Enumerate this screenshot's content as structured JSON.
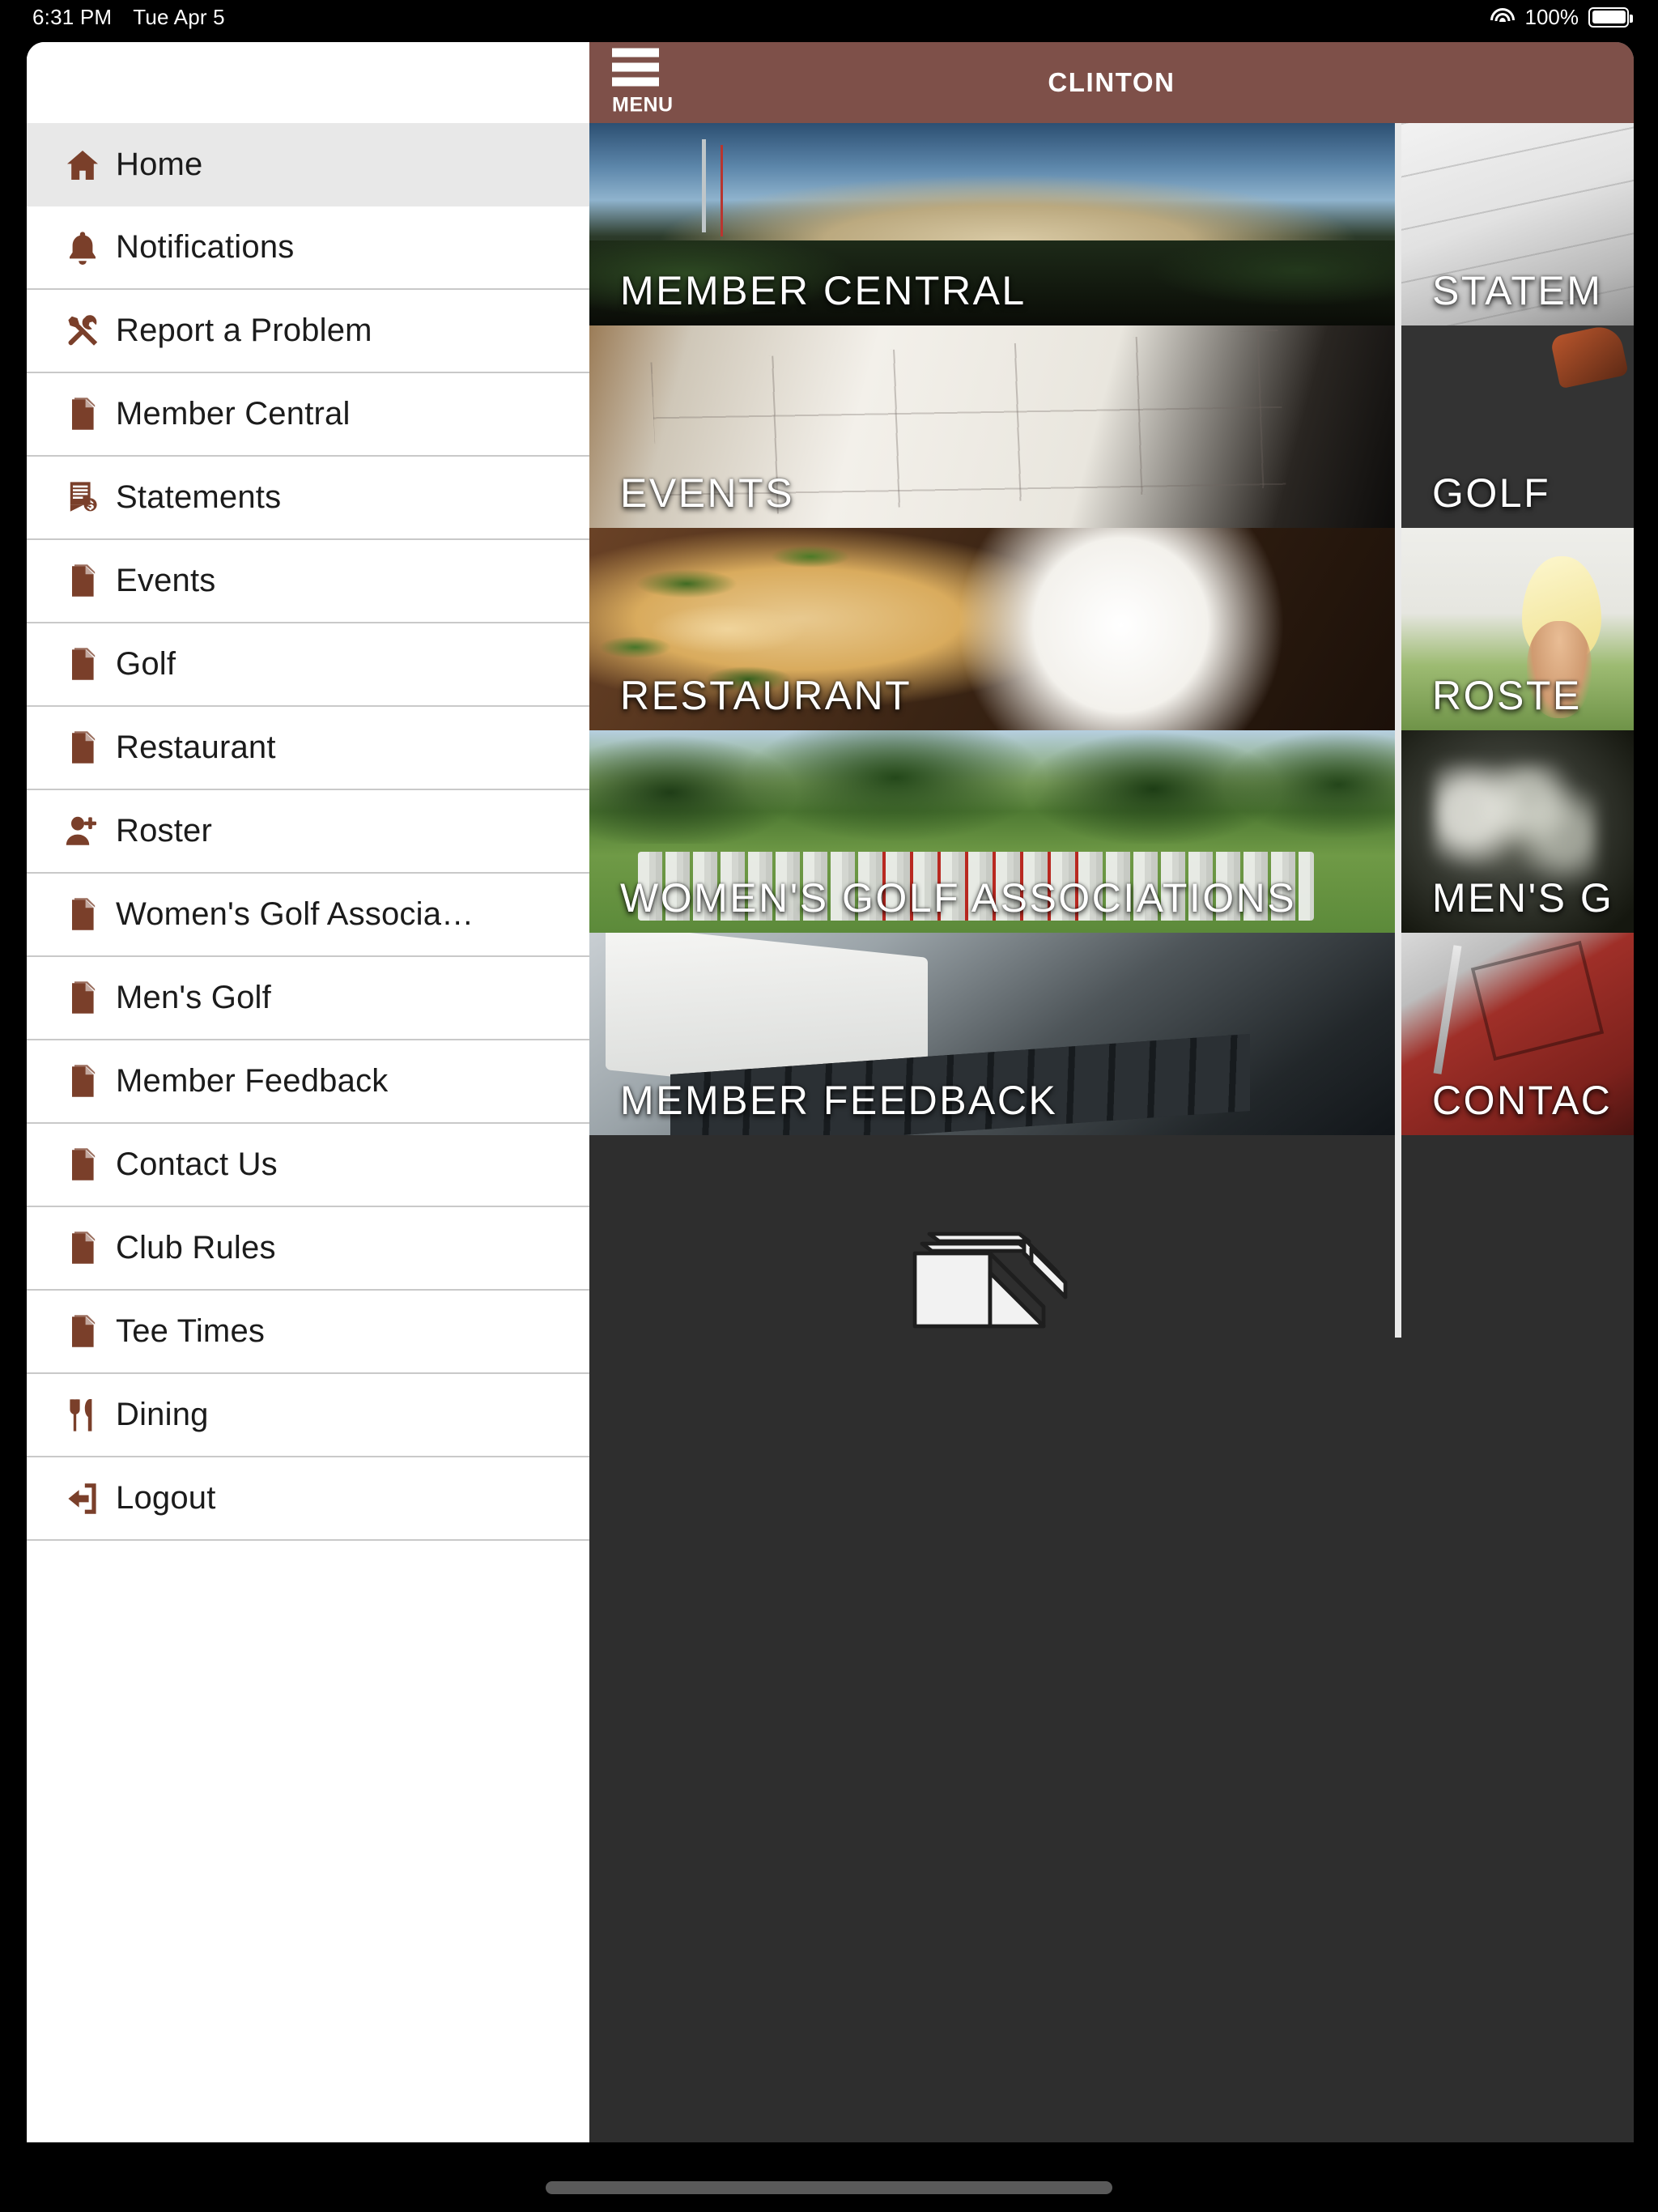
{
  "status_bar": {
    "time": "6:31 PM",
    "date": "Tue Apr 5",
    "battery_percent": "100%",
    "wifi_icon": "wifi-icon",
    "battery_icon": "battery-full-icon"
  },
  "header": {
    "menu_label": "MENU",
    "menu_icon": "hamburger-menu-icon",
    "title": "CLINTON",
    "background_color": "#7e5049"
  },
  "sidebar": {
    "background_color": "#ffffff",
    "icon_color": "#7a3f2a",
    "active_background": "#e8e8e8",
    "items": [
      {
        "label": "Home",
        "icon": "home-icon",
        "active": true
      },
      {
        "label": "Notifications",
        "icon": "bell-icon",
        "active": false
      },
      {
        "label": "Report a Problem",
        "icon": "tools-icon",
        "active": false
      },
      {
        "label": "Member Central",
        "icon": "document-icon",
        "active": false
      },
      {
        "label": "Statements",
        "icon": "invoice-dollar-icon",
        "active": false
      },
      {
        "label": "Events",
        "icon": "document-icon",
        "active": false
      },
      {
        "label": "Golf",
        "icon": "document-icon",
        "active": false
      },
      {
        "label": "Restaurant",
        "icon": "document-icon",
        "active": false
      },
      {
        "label": "Roster",
        "icon": "person-add-icon",
        "active": false
      },
      {
        "label": "Women's Golf Associa…",
        "icon": "document-icon",
        "active": false
      },
      {
        "label": "Men's Golf",
        "icon": "document-icon",
        "active": false
      },
      {
        "label": "Member Feedback",
        "icon": "document-icon",
        "active": false
      },
      {
        "label": "Contact Us",
        "icon": "document-icon",
        "active": false
      },
      {
        "label": "Club Rules",
        "icon": "document-icon",
        "active": false
      },
      {
        "label": "Tee Times",
        "icon": "document-icon",
        "active": false
      },
      {
        "label": "Dining",
        "icon": "cutlery-icon",
        "active": false
      },
      {
        "label": "Logout",
        "icon": "logout-icon",
        "active": false
      }
    ]
  },
  "tiles": [
    {
      "label": "MEMBER CENTRAL",
      "art": "art-clubhouse",
      "column": "left"
    },
    {
      "label": "STATEM",
      "art": "art-statement",
      "column": "right"
    },
    {
      "label": "EVENTS",
      "art": "art-calendar",
      "column": "left"
    },
    {
      "label": "GOLF",
      "art": "art-golfclubs",
      "column": "right"
    },
    {
      "label": "RESTAURANT",
      "art": "art-pasta",
      "column": "left"
    },
    {
      "label": "ROSTE",
      "art": "art-roster",
      "column": "right"
    },
    {
      "label": "WOMEN'S GOLF ASSOCIATIONS",
      "art": "art-wga",
      "column": "left"
    },
    {
      "label": "MEN'S G",
      "art": "art-mensgolf",
      "column": "right"
    },
    {
      "label": "MEMBER FEEDBACK",
      "art": "art-laptop",
      "column": "left"
    },
    {
      "label": "CONTAC",
      "art": "art-contact",
      "column": "right"
    }
  ],
  "footer": {
    "logo_icon": "document-stack-logo",
    "background_color": "#2e2e2e"
  }
}
